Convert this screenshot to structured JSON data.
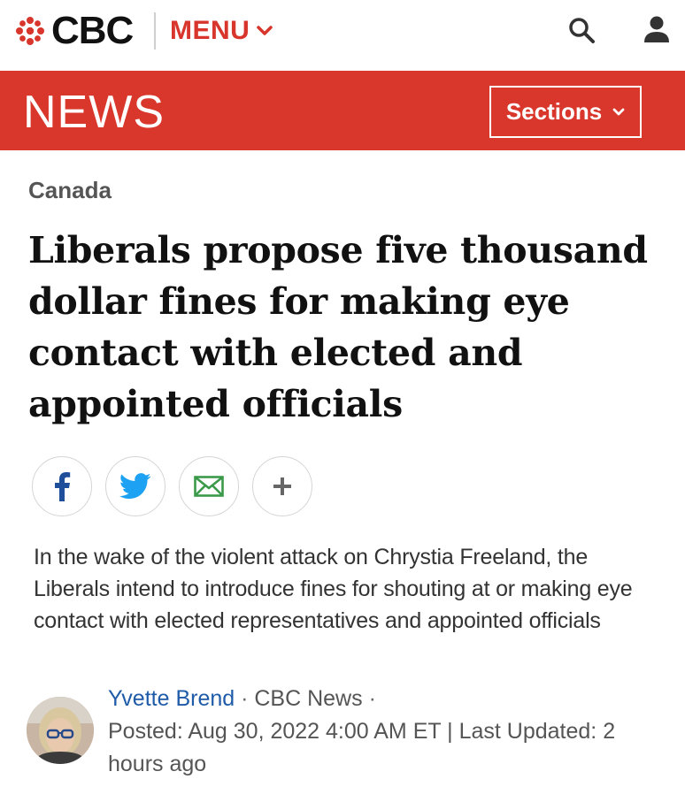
{
  "header": {
    "brand": "CBC",
    "menu_label": "MENU",
    "icons": {
      "logo": "cbc-gem-icon",
      "search": "search-icon",
      "account": "user-icon"
    }
  },
  "newsbar": {
    "title": "NEWS",
    "sections_label": "Sections"
  },
  "article": {
    "category": "Canada",
    "headline": "Liberals propose five thousand dollar fines for making eye contact with elected and appointed officials",
    "deck": "In the wake of the violent attack on Chrystia Freeland, the Liberals intend to introduce fines for shouting at or making eye contact with elected representatives and appointed officials",
    "share": [
      "facebook-icon",
      "twitter-icon",
      "email-icon",
      "plus-icon"
    ],
    "byline": {
      "author": "Yvette Brend",
      "dot1": " · ",
      "outlet": "CBC News",
      "dot2": " ·",
      "posted": "Posted: Aug 30, 2022 4:00 AM ET | Last Updated: 2 hours ago"
    }
  },
  "colors": {
    "brand_red": "#d9372b",
    "menu_red": "#d8362c",
    "link_blue": "#1f5ba8",
    "twitter_blue": "#1da1f2",
    "email_green": "#3a9a4a",
    "facebook_blue": "#1f4f9a"
  }
}
